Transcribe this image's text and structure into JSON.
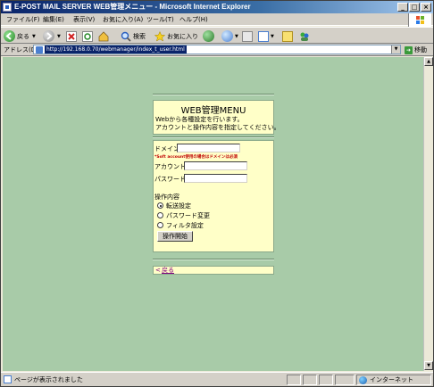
{
  "window": {
    "title": "E-POST MAIL SERVER WEB管理メニュー - Microsoft Internet Explorer",
    "controls": {
      "minimize": "_",
      "maximize": "□",
      "close": "×"
    }
  },
  "menubar": {
    "items": [
      "ファイル(F)",
      "編集(E)",
      "表示(V)",
      "お気に入り(A)",
      "ツール(T)",
      "ヘルプ(H)"
    ]
  },
  "toolbar": {
    "back_label": "戻る",
    "search_label": "検索",
    "favorites_label": "お気に入り"
  },
  "addressbar": {
    "label": "アドレス(D)",
    "url": "http://192.168.0.70/webmanager/index_t_user.html",
    "go_label": "移動"
  },
  "page": {
    "title": "WEB管理MENU",
    "description_line1": "Webから各種設定を行います。",
    "description_line2": "アカウントと操作内容を指定してください。",
    "domain_label": "ドメイン",
    "domain_value": "",
    "domain_note": "*Soft account使用の場合はドメインは必須",
    "account_label": "アカウント",
    "account_value": "",
    "password_label": "パスワード",
    "password_value": "",
    "operation_label": "操作内容",
    "options": [
      {
        "label": "転送設定",
        "selected": true
      },
      {
        "label": "パスワード変更",
        "selected": false
      },
      {
        "label": "フィルタ設定",
        "selected": false
      }
    ],
    "submit_label": "操作開始",
    "back_prefix": "<",
    "back_link": "戻る"
  },
  "statusbar": {
    "text": "ページが表示されました",
    "zone": "インターネット"
  },
  "colors": {
    "page_background": "#a8cba8",
    "panel_background": "#ffffc8",
    "note_color": "#c00000",
    "link_color": "#800080"
  }
}
